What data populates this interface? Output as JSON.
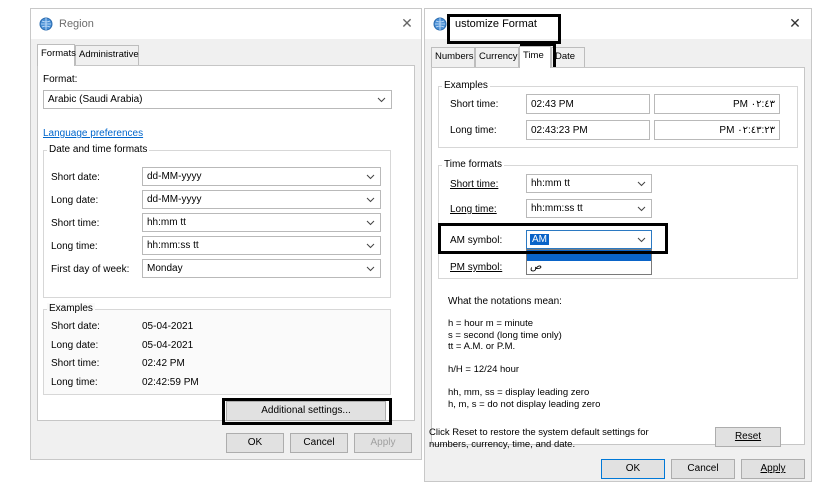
{
  "region_window": {
    "title": "Region",
    "tabs": [
      "Formats",
      "Administrative"
    ],
    "format_label": "Format:",
    "format_value": "Arabic (Saudi Arabia)",
    "language_link": "Language preferences",
    "date_time_group": "Date and time formats",
    "rows": [
      {
        "label": "Short date:",
        "value": "dd-MM-yyyy"
      },
      {
        "label": "Long date:",
        "value": "dd-MM-yyyy"
      },
      {
        "label": "Short time:",
        "value": "hh:mm tt"
      },
      {
        "label": "Long time:",
        "value": "hh:mm:ss tt"
      },
      {
        "label": "First day of week:",
        "value": "Monday"
      }
    ],
    "examples_group": "Examples",
    "examples": [
      {
        "label": "Short date:",
        "value": "05-04-2021"
      },
      {
        "label": "Long date:",
        "value": "05-04-2021"
      },
      {
        "label": "Short time:",
        "value": "02:42 PM"
      },
      {
        "label": "Long time:",
        "value": "02:42:59 PM"
      }
    ],
    "additional_settings": "Additional settings...",
    "ok": "OK",
    "cancel": "Cancel",
    "apply": "Apply"
  },
  "customize_window": {
    "title": "ustomize Format",
    "tabs": [
      "Numbers",
      "Currency",
      "Time",
      "Date"
    ],
    "examples_group": "Examples",
    "short_time_label": "Short time:",
    "short_time_value": "02:43 PM",
    "short_time_arabic": "PM ٠٢:٤٣",
    "long_time_label": "Long time:",
    "long_time_value": "02:43:23 PM",
    "long_time_arabic": "PM ٠٢:٤٣:٢٣",
    "time_formats_group": "Time formats",
    "short_time_format": "hh:mm tt",
    "long_time_format": "hh:mm:ss tt",
    "am_label": "AM symbol:",
    "am_value": "AM",
    "am_dropdown_option": "ص",
    "pm_label": "PM symbol:",
    "notations_title": "What the notations mean:",
    "notations": [
      "h = hour   m = minute",
      "s = second (long time only)",
      "tt = A.M. or P.M.",
      "",
      "h/H = 12/24 hour",
      "",
      "hh, mm, ss = display leading zero",
      "h, m, s = do not display leading zero"
    ],
    "reset_text_1": "Click Reset to restore the system default settings for",
    "reset_text_2": "numbers, currency, time, and date.",
    "reset": "Reset",
    "ok": "OK",
    "cancel": "Cancel",
    "apply": "Apply"
  }
}
